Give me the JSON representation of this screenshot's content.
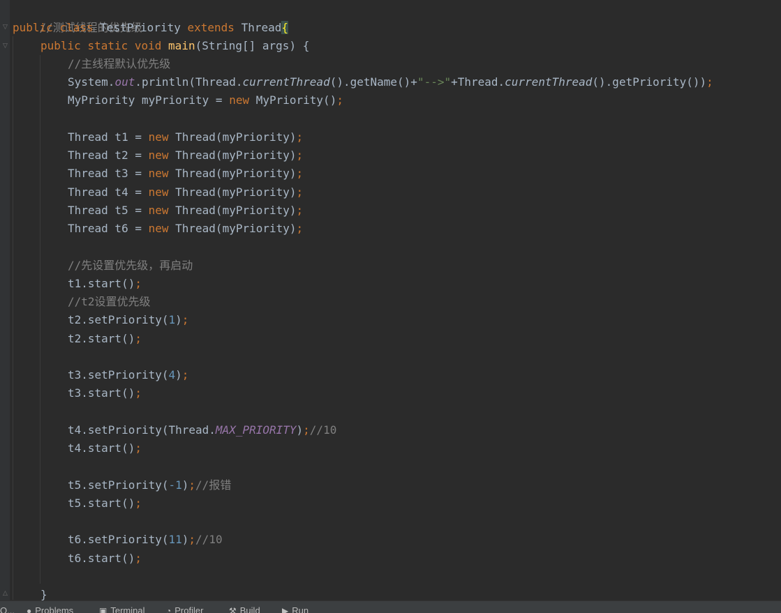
{
  "code": {
    "comment_header": "//测试线程的优先级",
    "kw_public": "public",
    "kw_class": "class",
    "class_name": "TestPriority",
    "kw_extends": "extends",
    "super_class": "Thread",
    "open_brace": "{",
    "kw_static": "static",
    "kw_void": "void",
    "main_name": "main",
    "main_params": "(String[] args) {",
    "comment_main_default": "//主线程默认优先级",
    "println_prefix": "System.",
    "println_out": "out",
    "println_call": ".println(Thread.",
    "current_thread": "currentThread",
    "get_name": "().getName()+",
    "arrow_str": "\"-->\"",
    "plus_thread": "+Thread.",
    "get_priority": "().getPriority())",
    "semicolon": ";",
    "my_priority_decl": "MyPriority myPriority = ",
    "kw_new": "new",
    "my_priority_ctor": " MyPriority()",
    "thread_decls": [
      {
        "head": "Thread t1 = ",
        "tail": " Thread(myPriority)"
      },
      {
        "head": "Thread t2 = ",
        "tail": " Thread(myPriority)"
      },
      {
        "head": "Thread t3 = ",
        "tail": " Thread(myPriority)"
      },
      {
        "head": "Thread t4 = ",
        "tail": " Thread(myPriority)"
      },
      {
        "head": "Thread t5 = ",
        "tail": " Thread(myPriority)"
      },
      {
        "head": "Thread t6 = ",
        "tail": " Thread(myPriority)"
      }
    ],
    "comment_set_first": "//先设置优先级，再启动",
    "t1_start": "t1.start()",
    "comment_t2": "//t2设置优先级",
    "t2_set_prefix": "t2.setPriority(",
    "t2_value": "1",
    "close_paren": ")",
    "t2_start": "t2.start()",
    "t3_set_prefix": "t3.setPriority(",
    "t3_value": "4",
    "t3_start": "t3.start()",
    "t4_set_prefix": "t4.setPriority(Thread.",
    "t4_const": "MAX_PRIORITY",
    "t4_comment": "//10",
    "t4_start": "t4.start()",
    "t5_set_prefix": "t5.setPriority(",
    "t5_value": "-1",
    "t5_comment": "//报错",
    "t5_start": "t5.start()",
    "t6_set_prefix": "t6.setPriority(",
    "t6_value": "11",
    "t6_comment": "//10",
    "t6_start": "t6.start()",
    "close_brace": "}"
  },
  "bottombar": {
    "partial_left": "Q...",
    "problems": "Problems",
    "terminal": "Terminal",
    "profiler": "Profiler",
    "build": "Build",
    "run": "Run"
  },
  "colors": {
    "background": "#2b2b2b",
    "keyword": "#cc7832",
    "comment": "#808080",
    "string": "#6a8759",
    "number": "#6897bb",
    "method_decl": "#ffc66d",
    "static_field": "#9876aa",
    "text": "#a9b7c6"
  }
}
